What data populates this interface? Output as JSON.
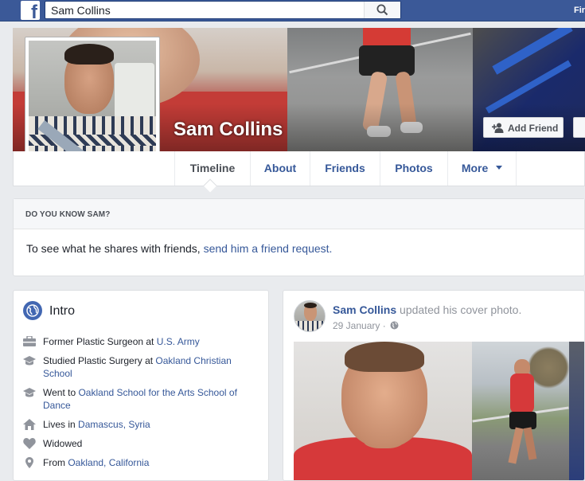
{
  "topbar": {
    "logo_letter": "f",
    "search_value": "Sam Collins",
    "search_icon": "search-icon",
    "right_text": "Fir"
  },
  "profile": {
    "name": "Sam Collins",
    "add_friend_label": "Add Friend"
  },
  "tabs": [
    {
      "label": "Timeline",
      "active": true
    },
    {
      "label": "About"
    },
    {
      "label": "Friends"
    },
    {
      "label": "Photos"
    },
    {
      "label": "More"
    }
  ],
  "know_box": {
    "header": "DO YOU KNOW SAM?",
    "text": "To see what he shares with friends, ",
    "link": "send him a friend request."
  },
  "intro": {
    "title": "Intro",
    "items": [
      {
        "icon": "briefcase-icon",
        "text": "Former Plastic Surgeon at ",
        "link": "U.S. Army"
      },
      {
        "icon": "graduation-cap-icon",
        "text": "Studied Plastic Surgery at ",
        "link": "Oakland Christian School"
      },
      {
        "icon": "graduation-cap-icon",
        "text": "Went to ",
        "link": "Oakland School for the Arts School of Dance"
      },
      {
        "icon": "home-icon",
        "text": "Lives in ",
        "link": "Damascus, Syria"
      },
      {
        "icon": "heart-icon",
        "text": "Widowed",
        "link": ""
      },
      {
        "icon": "location-pin-icon",
        "text": "From ",
        "link": "Oakland, California"
      }
    ]
  },
  "post": {
    "author": "Sam Collins",
    "action": " updated his cover photo.",
    "date": "29 January",
    "separator": " · ",
    "audience_icon": "globe-icon"
  },
  "colors": {
    "brand_blue": "#3b5998",
    "link_blue": "#365899",
    "background": "#e9ebee"
  }
}
